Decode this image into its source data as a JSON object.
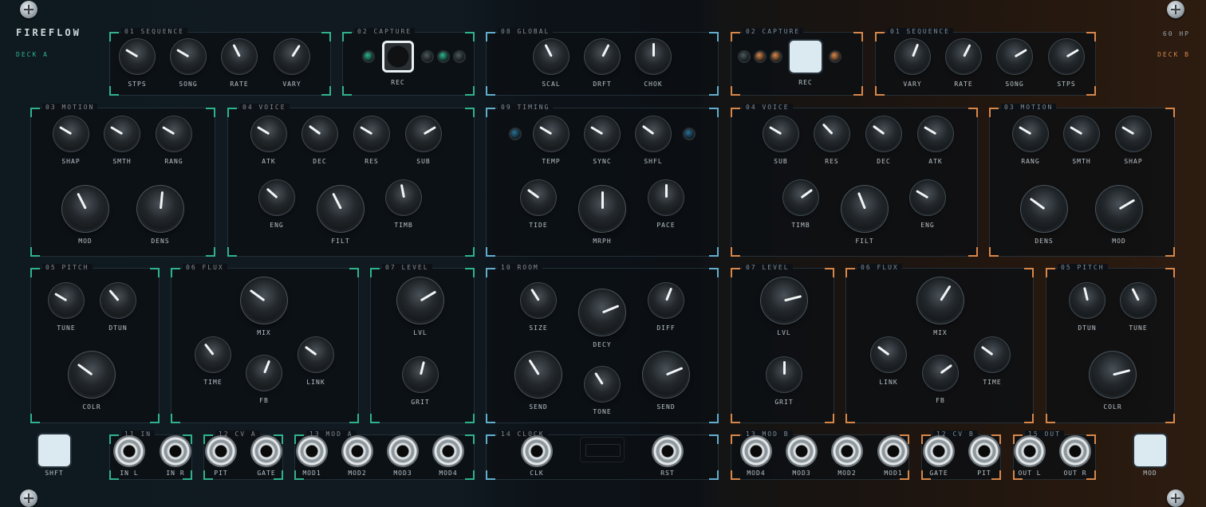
{
  "brand": "FIREFLOW",
  "deck_a": "DECK A",
  "deck_b": "DECK B",
  "hp_label": "60 HP",
  "colors": {
    "deck_a_accent": "#2fb38e",
    "global_accent": "#62aecf",
    "deck_b_accent": "#d8874a"
  },
  "sections": [
    {
      "id": "a-seq",
      "title": "01 SEQUENCE",
      "accent": "c",
      "knobs": [
        {
          "label": "STPS",
          "value": 0.28
        },
        {
          "label": "SONG",
          "value": 0.28
        },
        {
          "label": "RATE",
          "value": 0.4
        },
        {
          "label": "VARY",
          "value": 0.62
        }
      ]
    },
    {
      "id": "a-cap",
      "title": "02 CAPTURE",
      "accent": "c",
      "button": {
        "label": "REC"
      }
    },
    {
      "id": "g-glob",
      "title": "08 GLOBAL",
      "accent": "b",
      "knobs": [
        {
          "label": "SCAL",
          "value": 0.4
        },
        {
          "label": "DRFT",
          "value": 0.6
        },
        {
          "label": "CHOK",
          "value": 0.5
        }
      ]
    },
    {
      "id": "b-cap",
      "title": "02 CAPTURE",
      "accent": "o",
      "button": {
        "label": "REC"
      }
    },
    {
      "id": "b-seq",
      "title": "01 SEQUENCE",
      "accent": "o",
      "knobs": [
        {
          "label": "VARY",
          "value": 0.58
        },
        {
          "label": "RATE",
          "value": 0.6
        },
        {
          "label": "SONG",
          "value": 0.72
        },
        {
          "label": "STPS",
          "value": 0.72
        }
      ]
    },
    {
      "id": "a-mot",
      "title": "03 MOTION",
      "accent": "c",
      "knobs": [
        {
          "label": "SHAP",
          "value": 0.28
        },
        {
          "label": "SMTH",
          "value": 0.28
        },
        {
          "label": "RANG",
          "value": 0.28
        },
        {
          "label": "MOD",
          "value": 0.4
        },
        {
          "label": "DENS",
          "value": 0.52
        }
      ]
    },
    {
      "id": "a-voi",
      "title": "04 VOICE",
      "accent": "c",
      "knobs": [
        {
          "label": "ATK",
          "value": 0.28
        },
        {
          "label": "DEC",
          "value": 0.3
        },
        {
          "label": "RES",
          "value": 0.28
        },
        {
          "label": "SUB",
          "value": 0.72
        },
        {
          "label": "ENG",
          "value": 0.32
        },
        {
          "label": "FILT",
          "value": 0.4
        },
        {
          "label": "TIMB",
          "value": 0.46
        }
      ]
    },
    {
      "id": "g-tim",
      "title": "09 TIMING",
      "accent": "b",
      "knobs": [
        {
          "label": "TEMP",
          "value": 0.28
        },
        {
          "label": "SYNC",
          "value": 0.28
        },
        {
          "label": "SHFL",
          "value": 0.3
        },
        {
          "label": "TIDE",
          "value": 0.3
        },
        {
          "label": "MRPH",
          "value": 0.5
        },
        {
          "label": "PACE",
          "value": 0.5
        }
      ]
    },
    {
      "id": "b-voi",
      "title": "04 VOICE",
      "accent": "o",
      "knobs": [
        {
          "label": "SUB",
          "value": 0.28
        },
        {
          "label": "RES",
          "value": 0.34
        },
        {
          "label": "DEC",
          "value": 0.3
        },
        {
          "label": "ATK",
          "value": 0.28
        },
        {
          "label": "TIMB",
          "value": 0.7
        },
        {
          "label": "FILT",
          "value": 0.42
        },
        {
          "label": "ENG",
          "value": 0.28
        }
      ]
    },
    {
      "id": "b-mot",
      "title": "03 MOTION",
      "accent": "o",
      "knobs": [
        {
          "label": "RANG",
          "value": 0.28
        },
        {
          "label": "SMTH",
          "value": 0.28
        },
        {
          "label": "SHAP",
          "value": 0.28
        },
        {
          "label": "DENS",
          "value": 0.3
        },
        {
          "label": "MOD",
          "value": 0.72
        }
      ]
    },
    {
      "id": "a-pit",
      "title": "05 PITCH",
      "accent": "c",
      "knobs": [
        {
          "label": "TUNE",
          "value": 0.28
        },
        {
          "label": "DTUN",
          "value": 0.35
        },
        {
          "label": "COLR",
          "value": 0.3
        }
      ]
    },
    {
      "id": "a-flx",
      "title": "06 FLUX",
      "accent": "c",
      "knobs": [
        {
          "label": "MIX",
          "value": 0.3
        },
        {
          "label": "TIME",
          "value": 0.36
        },
        {
          "label": "FB",
          "value": 0.58
        },
        {
          "label": "LINK",
          "value": 0.3
        }
      ]
    },
    {
      "id": "a-lvl",
      "title": "07 LEVEL",
      "accent": "c",
      "knobs": [
        {
          "label": "LVL",
          "value": 0.72
        },
        {
          "label": "GRIT",
          "value": 0.55
        }
      ]
    },
    {
      "id": "g-room",
      "title": "10 ROOM",
      "accent": "b",
      "knobs": [
        {
          "label": "SIZE",
          "value": 0.38
        },
        {
          "label": "DECY",
          "value": 0.75
        },
        {
          "label": "DIFF",
          "value": 0.58
        },
        {
          "label": "SEND",
          "value": 0.38
        },
        {
          "label": "TONE",
          "value": 0.38
        },
        {
          "label": "SEND",
          "value": 0.75
        }
      ]
    },
    {
      "id": "b-lvl",
      "title": "07 LEVEL",
      "accent": "o",
      "knobs": [
        {
          "label": "LVL",
          "value": 0.78
        },
        {
          "label": "GRIT",
          "value": 0.5
        }
      ]
    },
    {
      "id": "b-flx",
      "title": "06 FLUX",
      "accent": "o",
      "knobs": [
        {
          "label": "MIX",
          "value": 0.62
        },
        {
          "label": "LINK",
          "value": 0.3
        },
        {
          "label": "FB",
          "value": 0.7
        },
        {
          "label": "TIME",
          "value": 0.3
        }
      ]
    },
    {
      "id": "b-pit",
      "title": "05 PITCH",
      "accent": "o",
      "knobs": [
        {
          "label": "DTUN",
          "value": 0.45
        },
        {
          "label": "TUNE",
          "value": 0.4
        },
        {
          "label": "COLR",
          "value": 0.78
        }
      ]
    },
    {
      "id": "j-in",
      "title": "11 IN",
      "accent": "c",
      "jacks": [
        "IN L",
        "IN R"
      ]
    },
    {
      "id": "j-cva",
      "title": "12 CV A",
      "accent": "c",
      "jacks": [
        "PIT",
        "GATE"
      ]
    },
    {
      "id": "j-moda",
      "title": "13 MOD A",
      "accent": "c",
      "jacks": [
        "MOD1",
        "MOD2",
        "MOD3",
        "MOD4"
      ]
    },
    {
      "id": "j-clk",
      "title": "14 CLOCK",
      "accent": "b",
      "jacks": [
        "CLK",
        "RST"
      ]
    },
    {
      "id": "j-modb",
      "title": "13 MOD B",
      "accent": "o",
      "jacks": [
        "MOD4",
        "MOD3",
        "MOD2",
        "MOD1"
      ]
    },
    {
      "id": "j-cvb",
      "title": "12 CV B",
      "accent": "o",
      "jacks": [
        "GATE",
        "PIT"
      ]
    },
    {
      "id": "j-out",
      "title": "15 OUT",
      "accent": "o",
      "jacks": [
        "OUT L",
        "OUT R"
      ]
    }
  ],
  "side_buttons": {
    "shift": "SHFT",
    "mod": "MOD"
  }
}
